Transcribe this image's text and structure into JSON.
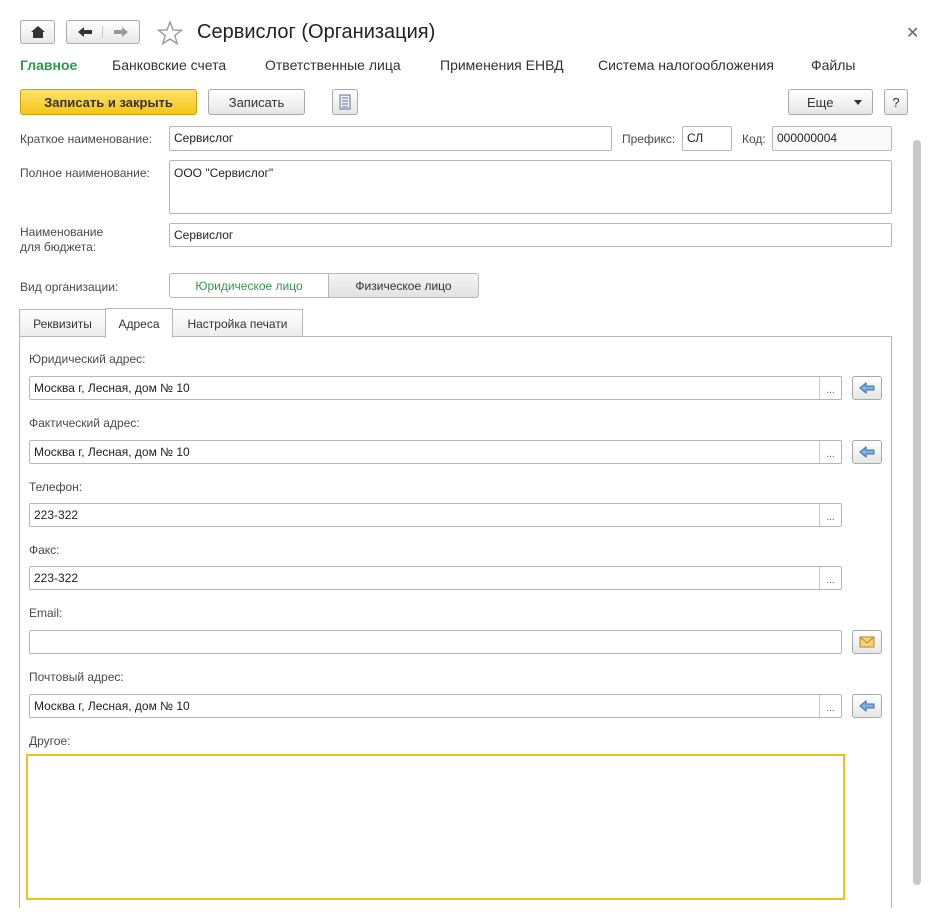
{
  "window": {
    "title": "Сервислог (Организация)"
  },
  "top_tabs": [
    "Главное",
    "Банковские счета",
    "Ответственные лица",
    "Применения ЕНВД",
    "Система налогообложения",
    "Файлы"
  ],
  "toolbar": {
    "save_close": "Записать и закрыть",
    "save": "Записать",
    "more": "Еще",
    "help": "?"
  },
  "form": {
    "short_name_label": "Краткое наименование:",
    "short_name": "Сервислог",
    "prefix_label": "Префикс:",
    "prefix": "СЛ",
    "code_label": "Код:",
    "code": "000000004",
    "full_name_label": "Полное наименование:",
    "full_name": "ООО \"Сервислог\"",
    "budget_label_1": "Наименование",
    "budget_label_2": "для бюджета:",
    "budget_name": "Сервислог",
    "org_type_label": "Вид организации:",
    "org_types": [
      "Юридическое лицо",
      "Физическое лицо"
    ],
    "org_type_selected": "Юридическое лицо"
  },
  "page_tabs": [
    "Реквизиты",
    "Адреса",
    "Настройка печати"
  ],
  "page_tab_active": "Адреса",
  "addresses": {
    "legal_label": "Юридический адрес:",
    "legal": "Москва г, Лесная, дом № 10",
    "actual_label": "Фактический адрес:",
    "actual": "Москва г, Лесная, дом № 10",
    "phone_label": "Телефон:",
    "phone": "223-322",
    "fax_label": "Факс:",
    "fax": "223-322",
    "email_label": "Email:",
    "email": "",
    "postal_label": "Почтовый адрес:",
    "postal": "Москва г, Лесная, дом № 10",
    "other_label": "Другое:",
    "other": ""
  },
  "colors": {
    "accent_green": "#2e9b4a",
    "primary_yellow": "#f5c518",
    "focus_border": "#f0c020"
  },
  "icons": [
    "home-icon",
    "back-arrow-icon",
    "forward-arrow-icon",
    "star-icon",
    "close-icon",
    "report-icon",
    "chevron-down-icon",
    "fill-arrow-icon",
    "envelope-icon"
  ]
}
